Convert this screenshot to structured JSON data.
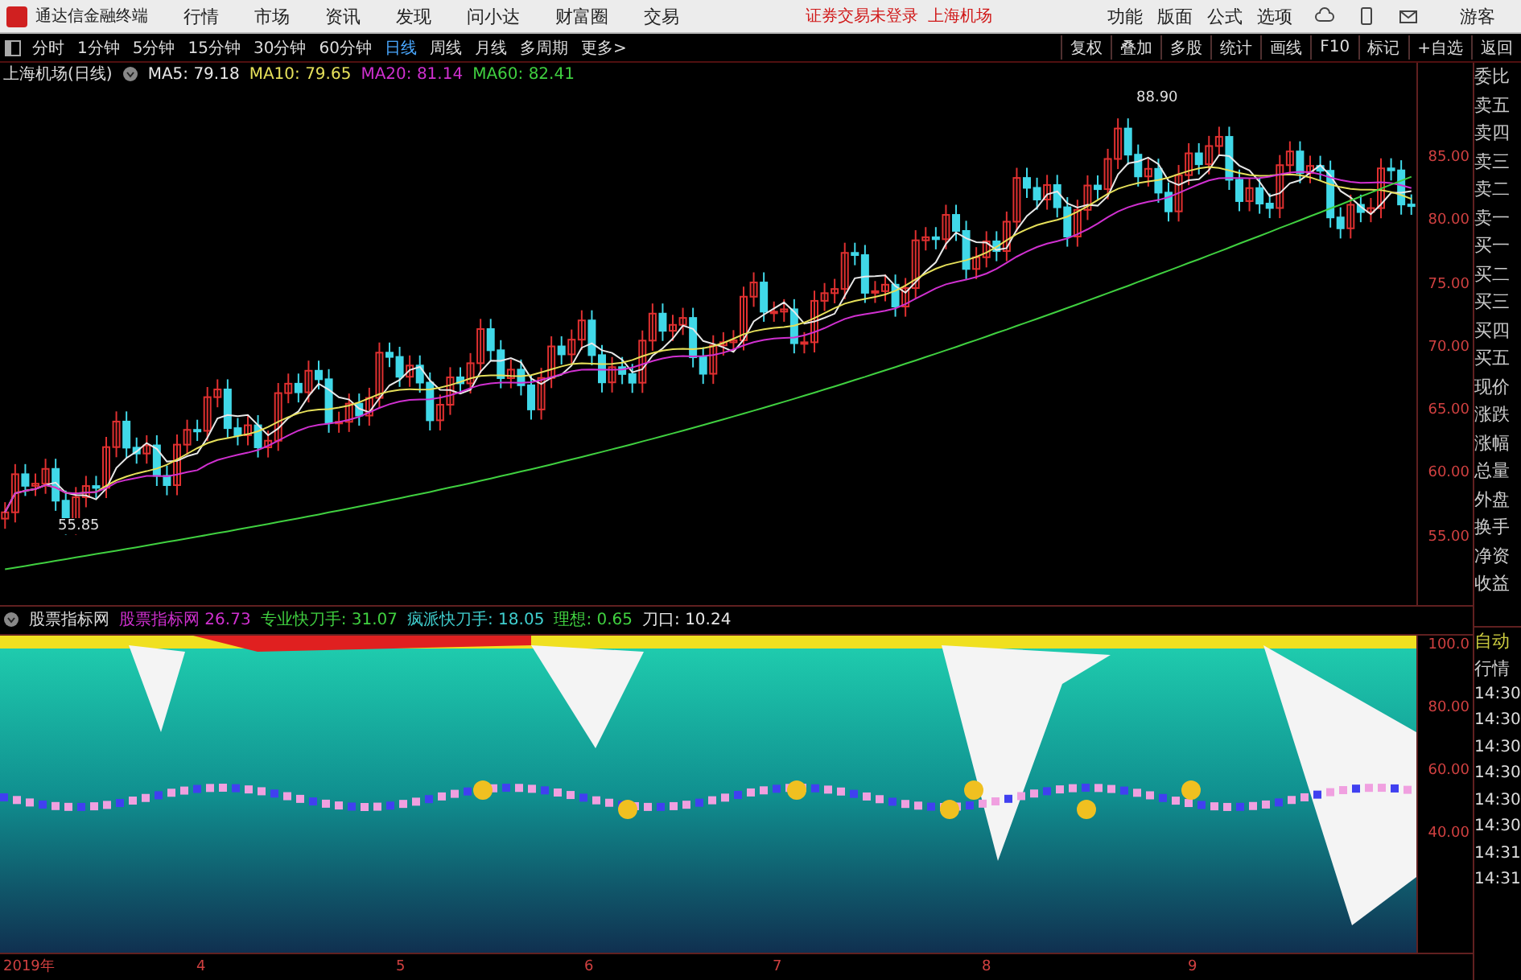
{
  "menu_bar": {
    "app_name": "通达信金融终端",
    "items": [
      "行情",
      "市场",
      "资讯",
      "发现",
      "问小达",
      "财富圈",
      "交易"
    ],
    "notices": [
      "证券交易未登录",
      "上海机场"
    ],
    "tools": [
      "功能",
      "版面",
      "公式",
      "选项"
    ],
    "user": "游客"
  },
  "toolbar": {
    "periods": [
      {
        "label": "分时",
        "selected": false
      },
      {
        "label": "1分钟",
        "selected": false
      },
      {
        "label": "5分钟",
        "selected": false
      },
      {
        "label": "15分钟",
        "selected": false
      },
      {
        "label": "30分钟",
        "selected": false
      },
      {
        "label": "60分钟",
        "selected": false
      },
      {
        "label": "日线",
        "selected": true
      },
      {
        "label": "周线",
        "selected": false
      },
      {
        "label": "月线",
        "selected": false
      },
      {
        "label": "多周期",
        "selected": false
      },
      {
        "label": "更多>",
        "selected": false
      }
    ],
    "actions": [
      "复权",
      "叠加",
      "多股",
      "统计",
      "画线",
      "F10",
      "标记",
      "+自选",
      "返回"
    ]
  },
  "price_chart": {
    "title": "上海机场(日线)",
    "indicators": [
      {
        "label": "MA5: 79.18",
        "color": "#e8e8e8"
      },
      {
        "label": "MA10: 79.65",
        "color": "#e6e05a"
      },
      {
        "label": "MA20: 81.14",
        "color": "#d030d0"
      },
      {
        "label": "MA60: 82.41",
        "color": "#40d040"
      }
    ],
    "y_labels": [
      "85.00",
      "80.00",
      "75.00",
      "70.00",
      "65.00",
      "60.00",
      "55.00"
    ],
    "high_label": "88.90",
    "low_label": "55.85"
  },
  "indicator_panel": {
    "name": "股票指标网",
    "values": [
      {
        "label": "股票指标网 26.73",
        "color": "#d030d0"
      },
      {
        "label": "专业快刀手: 31.07",
        "color": "#40d040"
      },
      {
        "label": "疯派快刀手: 18.05",
        "color": "#40d0d0"
      },
      {
        "label": "理想: 0.65",
        "color": "#40d040"
      },
      {
        "label": "刀口: 10.24",
        "color": "#e8e8e8"
      }
    ],
    "y_labels": [
      "100.0",
      "80.00",
      "60.00",
      "40.00"
    ]
  },
  "x_axis": [
    "2019年",
    "4",
    "5",
    "6",
    "7",
    "8",
    "9"
  ],
  "sidebar": {
    "quote_labels": [
      "委比",
      "卖五",
      "卖四",
      "卖三",
      "卖二",
      "卖一",
      "买一",
      "买二",
      "买三",
      "买四",
      "买五",
      "现价",
      "涨跌",
      "涨幅",
      "总量",
      "外盘",
      "换手",
      "净资",
      "收益"
    ],
    "modes": [
      "自动",
      "行情"
    ],
    "times": [
      "14:30",
      "14:30",
      "14:30",
      "14:30",
      "14:30",
      "14:30",
      "14:31",
      "14:31"
    ]
  }
}
